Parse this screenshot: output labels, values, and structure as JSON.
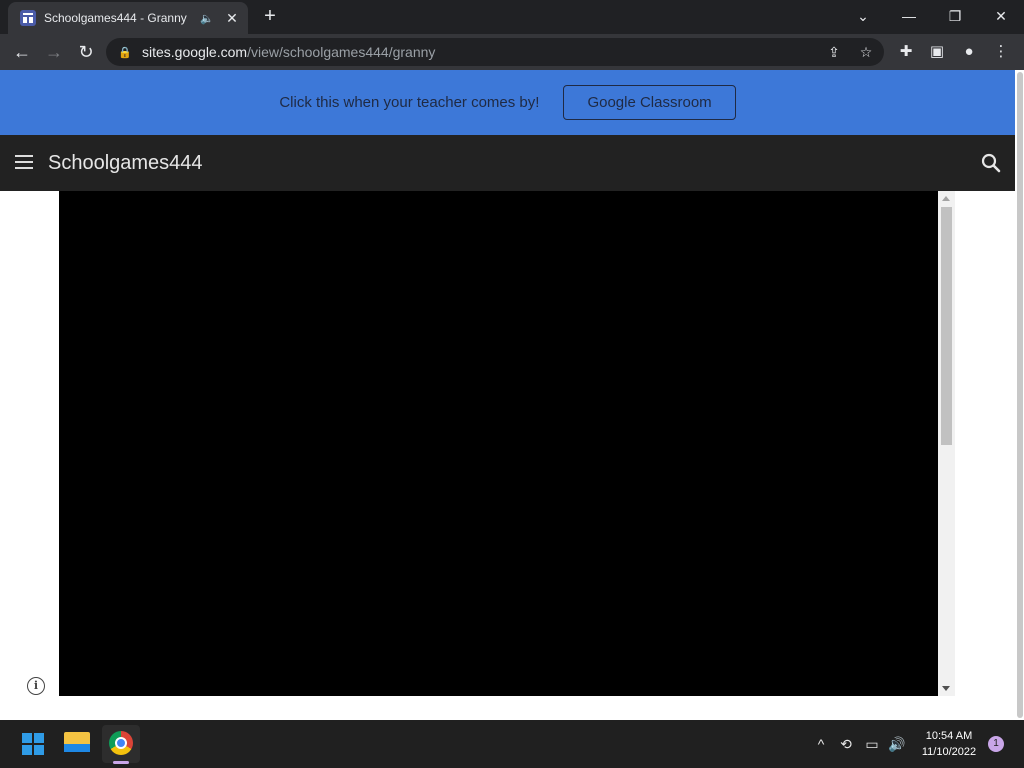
{
  "browser": {
    "tab": {
      "title": "Schoolgames444 - Granny",
      "audio_icon": "speaker-icon",
      "close_icon": "close-icon"
    },
    "new_tab_icon": "plus-icon",
    "window_controls": {
      "tab_search": "⌄",
      "minimize": "—",
      "restore": "❐",
      "close": "✕"
    },
    "nav": {
      "back": "←",
      "forward": "→",
      "reload": "↻"
    },
    "url": {
      "host": "sites.google.com",
      "path": "/view/schoolgames444/granny"
    },
    "toolbar_icons": [
      "share-icon",
      "star-icon",
      "extensions-icon",
      "side-panel-icon",
      "profile-icon",
      "menu-icon"
    ]
  },
  "page": {
    "banner": {
      "text": "Click this when your teacher comes by!",
      "button_label": "Google Classroom"
    },
    "header": {
      "site_title": "Schoolgames444"
    },
    "info_label": "i"
  },
  "taskbar": {
    "apps": [
      "start-icon",
      "file-explorer-icon",
      "chrome-icon"
    ],
    "tray": {
      "chevron": "^",
      "time": "10:54 AM",
      "date": "11/10/2022",
      "notification_count": "1"
    }
  },
  "colors": {
    "banner": "#3d78d8",
    "header": "#222222",
    "accent": "#c9a6e8"
  }
}
